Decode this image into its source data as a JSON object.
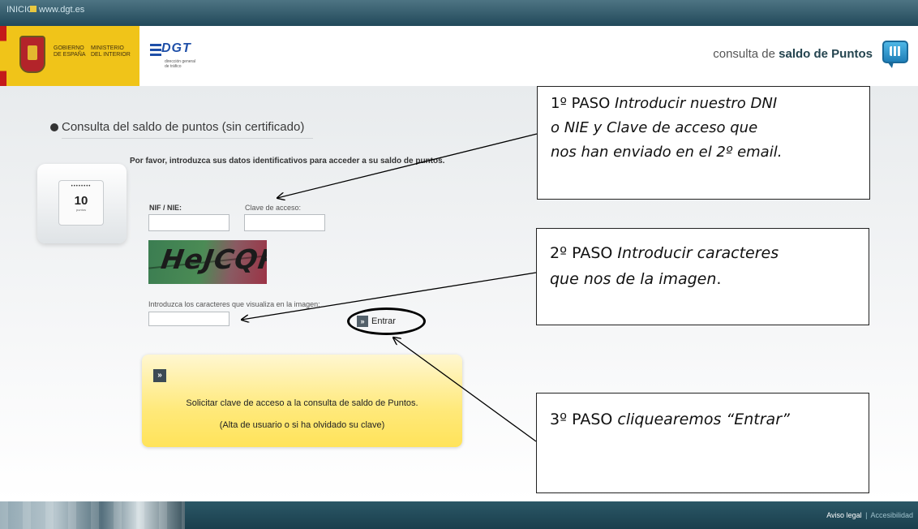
{
  "topbar": {
    "inicio": "INICIO",
    "site": "www.dgt.es"
  },
  "header": {
    "gov_line1": "GOBIERNO DE ESPAÑA",
    "gov_line2": "MINISTERIO DEL INTERIOR",
    "dgt_logo": "DGT",
    "dgt_sub": "dirección general de tráfico",
    "brand_pre": "consulta de ",
    "brand_bold": "saldo de Puntos"
  },
  "form": {
    "section_title": "Consulta del saldo de puntos (sin certificado)",
    "intro": "Por favor, introduzca sus datos identificativos para acceder a su saldo de puntos.",
    "card_dots": "••••••••",
    "card_number": "10",
    "card_label": "puntos",
    "nif_label": "NIF / NIE:",
    "nif_value": "",
    "clave_label": "Clave de acceso:",
    "clave_value": "",
    "captcha_text": "HeJCQR",
    "captcha_label": "Introduzca los caracteres que visualiza en la imagen:",
    "captcha_value": "",
    "submit_arrow": "»",
    "submit_label": "Entrar"
  },
  "request_box": {
    "arrow": "»",
    "line1": "Solicitar clave de acceso a la consulta de saldo de Puntos.",
    "line2": "(Alta de usuario o si ha olvidado su clave)"
  },
  "annotations": {
    "step1_prefix": "1º PASO ",
    "step1_l1": "Introducir nuestro DNI",
    "step1_l2": "o NIE y Clave de acceso que",
    "step1_l3": "nos han enviado en el 2º email.",
    "step2_prefix": "2º PASO ",
    "step2_l1": "Introducir caracteres",
    "step2_l2": "que nos de la imagen",
    "step2_l2_end": ".",
    "step3_prefix": "3º PASO ",
    "step3_text": "cliquearemos “Entrar”"
  },
  "footer": {
    "aviso": "Aviso legal",
    "sep": "|",
    "accesibilidad": "Accesibilidad"
  }
}
